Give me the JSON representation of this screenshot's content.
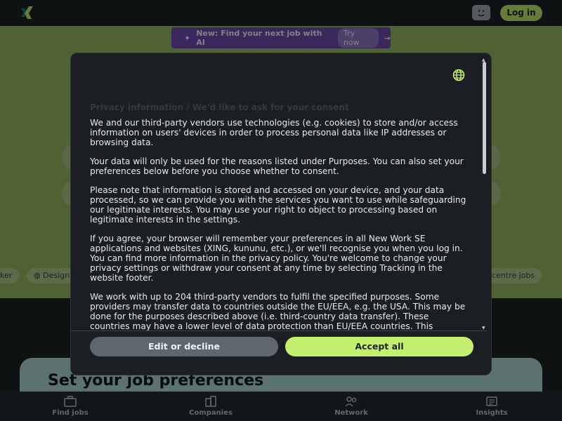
{
  "header": {
    "login_label": "Log in"
  },
  "banner": {
    "text": "New: Find your next job with AI",
    "try_label": "Try now",
    "arrow": "→"
  },
  "chips": [
    "ker",
    "Design",
    "centre jobs"
  ],
  "prefs": {
    "title": "Set your job preferences"
  },
  "nav": {
    "items": [
      {
        "label": "Find jobs",
        "icon": "briefcase-icon"
      },
      {
        "label": "Companies",
        "icon": "building-icon"
      },
      {
        "label": "Network",
        "icon": "people-icon"
      },
      {
        "label": "Insights",
        "icon": "news-icon"
      }
    ]
  },
  "consent": {
    "faded_title": "Privacy information / We'd like to ask for your consent",
    "paragraphs": [
      "We and our third-party vendors use technologies (e.g. cookies) to store and/or access information on users' devices in order to process personal data like IP addresses or browsing data.",
      "Your data will only be used for the reasons listed under Purposes. You can also set your preferences below before you choose whether to consent.",
      "Please note that information is stored and accessed on your device, and your data processed, so we can provide you with the services you want to use while safeguarding our legitimate interests. You may use your right to object to processing based on legitimate interests in the settings.",
      "If you agree, your browser will remember your preferences in all New Work SE applications and websites (XING, kununu, etc.), or we'll recognise you when you log in. You can find more information in the privacy policy. You're welcome to change your privacy settings or withdraw your consent at any time by selecting Tracking in the website footer.",
      "We work with up to 204 third-party vendors to fulfil the specified purposes. Some providers may transfer data to countries outside the EU/EEA, e.g. the USA. This may be done for the purposes described above (i.e. third-country data transfer). These countries may have a lower level of data protection than EU/EEA countries. This"
    ],
    "edit_label": "Edit or decline",
    "accept_label": "Accept all"
  },
  "colors": {
    "accent": "#c4f06f",
    "hero_green": "#8fb35f",
    "dialog_bg": "#1b1e22",
    "banner_purple": "#6a4aa8"
  }
}
